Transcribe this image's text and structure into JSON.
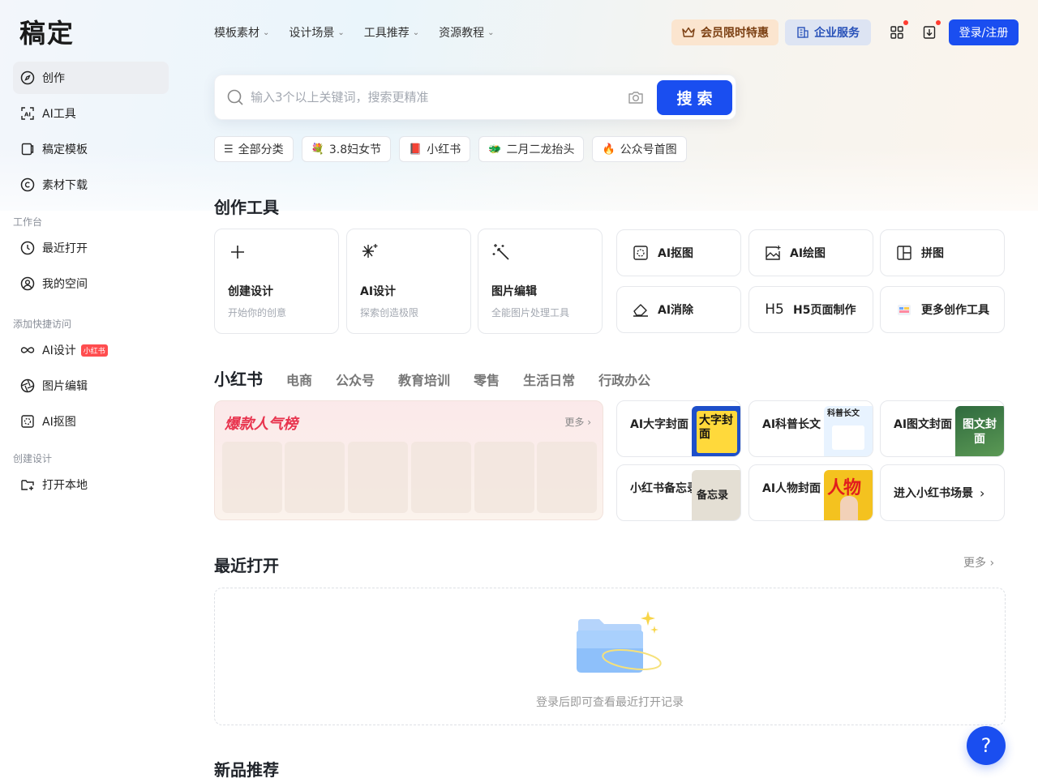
{
  "app": {
    "logo": "稿定"
  },
  "sidebar": {
    "items": [
      {
        "label": "创作",
        "icon": "compass-icon"
      },
      {
        "label": "AI工具",
        "icon": "ai-scan-icon"
      },
      {
        "label": "稿定模板",
        "icon": "template-icon"
      },
      {
        "label": "素材下载",
        "icon": "copyright-icon"
      }
    ],
    "workspace_title": "工作台",
    "workspace": [
      {
        "label": "最近打开",
        "icon": "clock-icon"
      },
      {
        "label": "我的空间",
        "icon": "user-circle-icon"
      }
    ],
    "quick_title": "添加快捷访问",
    "quick": [
      {
        "label": "AI设计",
        "badge": "小红书",
        "icon": "infinity-icon"
      },
      {
        "label": "图片编辑",
        "icon": "aperture-icon"
      },
      {
        "label": "AI抠图",
        "icon": "cutout-icon"
      }
    ],
    "create_title": "创建设计",
    "create": [
      {
        "label": "打开本地",
        "icon": "folder-plus-icon"
      }
    ]
  },
  "header": {
    "nav": [
      "模板素材",
      "设计场景",
      "工具推荐",
      "资源教程"
    ],
    "vip_label": "会员限时特惠",
    "enterprise_label": "企业服务",
    "login_label": "登录/注册"
  },
  "search": {
    "placeholder": "输入3个以上关键词，搜索更精准",
    "button": "搜索"
  },
  "chips": [
    {
      "icon": "menu-icon",
      "glyph": "☰",
      "label": "全部分类"
    },
    {
      "icon": "bouquet-icon",
      "glyph": "💐",
      "label": "3.8妇女节"
    },
    {
      "icon": "book-icon",
      "glyph": "📕",
      "label": "小红书"
    },
    {
      "icon": "dragon-icon",
      "glyph": "🐲",
      "label": "二月二龙抬头"
    },
    {
      "icon": "fire-icon",
      "glyph": "🔥",
      "label": "公众号首图"
    }
  ],
  "tools": {
    "title": "创作工具",
    "big": [
      {
        "title": "创建设计",
        "sub": "开始你的创意"
      },
      {
        "title": "AI设计",
        "sub": "探索创造极限"
      },
      {
        "title": "图片编辑",
        "sub": "全能图片处理工具"
      }
    ],
    "small": [
      "AI抠图",
      "AI绘图",
      "拼图",
      "AI消除",
      "H5页面制作",
      "更多创作工具"
    ]
  },
  "scenes": {
    "tabs": [
      "小红书",
      "电商",
      "公众号",
      "教育培训",
      "零售",
      "生活日常",
      "行政办公"
    ],
    "hot_title": "爆款人气榜",
    "hot_more": "更多",
    "cards": [
      {
        "title": "AI大字封面",
        "thumb_text": "大字封面"
      },
      {
        "title": "AI科普长文",
        "thumb_text": "科普长文"
      },
      {
        "title": "AI图文封面",
        "thumb_text": "图文封面"
      },
      {
        "title": "小红书备忘录",
        "thumb_text": "备忘录"
      },
      {
        "title": "AI人物封面",
        "thumb_text": "人物"
      }
    ],
    "enter_label": "进入小红书场景"
  },
  "recent": {
    "title": "最近打开",
    "more": "更多",
    "empty_text": "登录后即可查看最近打开记录"
  },
  "new_title": "新品推荐",
  "help_label": "?"
}
